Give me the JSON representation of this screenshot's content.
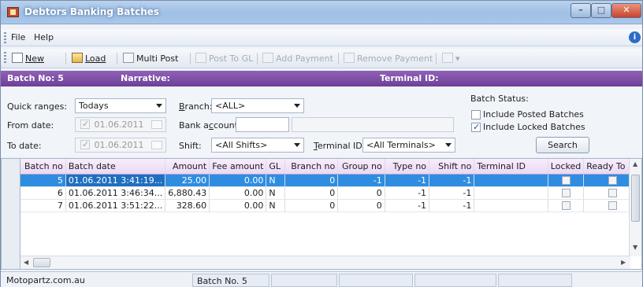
{
  "window": {
    "title": "Debtors Banking Batches"
  },
  "menu": {
    "items": [
      "File",
      "Help"
    ]
  },
  "toolbar": {
    "new": "New",
    "load": "Load",
    "multi_post": "Multi Post",
    "post_to_gl": "Post To GL",
    "add_payment": "Add Payment",
    "remove_payment": "Remove Payment"
  },
  "header": {
    "batch_no": "Batch No: 5",
    "narrative": "Narrative:",
    "terminal_id": "Terminal ID:"
  },
  "filters": {
    "quick_ranges_label": "Quick ranges:",
    "quick_ranges_value": "Todays",
    "from_date_label": "From date:",
    "from_date_value": "01.06.2011",
    "to_date_label": "To date:",
    "to_date_value": "01.06.2011",
    "branch_label": "Branch:",
    "branch_value": "<ALL>",
    "bank_account_label": "Bank account:",
    "bank_account_value": "",
    "shift_label": "Shift:",
    "shift_value": "<All Shifts>",
    "terminal_label": "Terminal ID:",
    "terminal_value": "<All Terminals>",
    "batch_status_label": "Batch Status:",
    "include_posted_label": "Include Posted Batches",
    "include_posted_checked": false,
    "include_locked_label": "Include Locked Batches",
    "include_locked_checked": true,
    "search_label": "Search"
  },
  "grid": {
    "columns": [
      "Batch no",
      "Batch date",
      "Amount",
      "Fee amount",
      "GL",
      "Branch no",
      "Group no",
      "Type no",
      "Shift no",
      "Terminal ID",
      "Locked",
      "Ready To Po"
    ],
    "rows": [
      {
        "batch_no": "5",
        "batch_date": "01.06.2011 3:41:19...",
        "amount": "25.00",
        "fee_amount": "0.00",
        "gl": "N",
        "branch_no": "0",
        "group_no": "-1",
        "type_no": "-1",
        "shift_no": "-1",
        "terminal_id": "",
        "locked": false,
        "ready": false,
        "selected": true
      },
      {
        "batch_no": "6",
        "batch_date": "01.06.2011 3:46:34...",
        "amount": "6,880.43",
        "fee_amount": "0.00",
        "gl": "N",
        "branch_no": "0",
        "group_no": "0",
        "type_no": "-1",
        "shift_no": "-1",
        "terminal_id": "",
        "locked": false,
        "ready": false,
        "selected": false
      },
      {
        "batch_no": "7",
        "batch_date": "01.06.2011 3:51:22...",
        "amount": "328.60",
        "fee_amount": "0.00",
        "gl": "N",
        "branch_no": "0",
        "group_no": "0",
        "type_no": "-1",
        "shift_no": "-1",
        "terminal_id": "",
        "locked": false,
        "ready": false,
        "selected": false
      }
    ]
  },
  "status": {
    "company": "Motopartz.com.au",
    "batch": "Batch No. 5"
  }
}
